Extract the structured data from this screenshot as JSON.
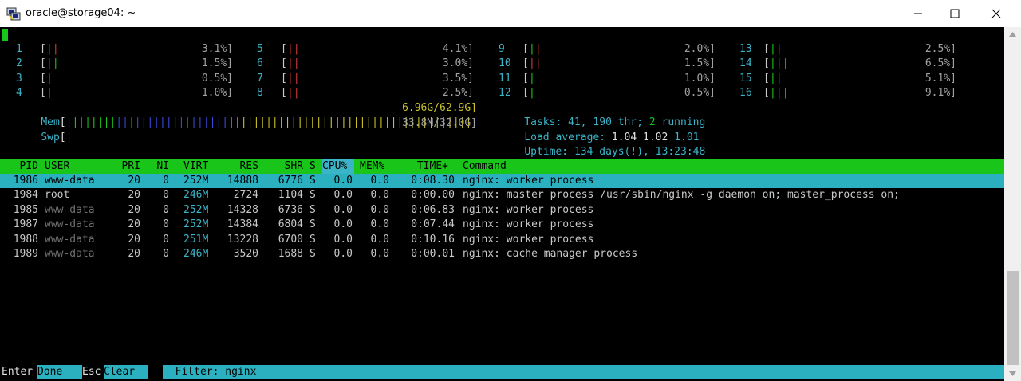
{
  "window": {
    "title": "oracle@storage04: ~"
  },
  "cpus": [
    {
      "id": "1",
      "bars": [
        [
          "r",
          2
        ]
      ],
      "pct": "3.1%]"
    },
    {
      "id": "2",
      "bars": [
        [
          "r",
          1
        ],
        [
          "g",
          1
        ]
      ],
      "pct": "1.5%]"
    },
    {
      "id": "3",
      "bars": [
        [
          "g",
          1
        ]
      ],
      "pct": "0.5%]"
    },
    {
      "id": "4",
      "bars": [
        [
          "g",
          1
        ]
      ],
      "pct": "1.0%]"
    },
    {
      "id": "5",
      "bars": [
        [
          "r",
          2
        ]
      ],
      "pct": "4.1%]"
    },
    {
      "id": "6",
      "bars": [
        [
          "r",
          2
        ]
      ],
      "pct": "3.0%]"
    },
    {
      "id": "7",
      "bars": [
        [
          "r",
          2
        ]
      ],
      "pct": "3.5%]"
    },
    {
      "id": "8",
      "bars": [
        [
          "r",
          2
        ]
      ],
      "pct": "2.5%]"
    },
    {
      "id": "9",
      "bars": [
        [
          "g",
          1
        ],
        [
          "r",
          1
        ]
      ],
      "pct": "2.0%]"
    },
    {
      "id": "10",
      "bars": [
        [
          "r",
          2
        ]
      ],
      "pct": "1.5%]"
    },
    {
      "id": "11",
      "bars": [
        [
          "g",
          1
        ]
      ],
      "pct": "1.0%]"
    },
    {
      "id": "12",
      "bars": [
        [
          "g",
          1
        ]
      ],
      "pct": "0.5%]"
    },
    {
      "id": "13",
      "bars": [
        [
          "g",
          1
        ],
        [
          "r",
          1
        ]
      ],
      "pct": "2.5%]"
    },
    {
      "id": "14",
      "bars": [
        [
          "g",
          1
        ],
        [
          "r",
          2
        ]
      ],
      "pct": "6.5%]"
    },
    {
      "id": "15",
      "bars": [
        [
          "g",
          1
        ],
        [
          "r",
          1
        ]
      ],
      "pct": "5.1%]"
    },
    {
      "id": "16",
      "bars": [
        [
          "g",
          1
        ],
        [
          "r",
          2
        ]
      ],
      "pct": "9.1%]"
    }
  ],
  "mem": {
    "label": "Mem",
    "value": "6.96G/62.9G]"
  },
  "swp": {
    "label": "Swp",
    "value": "33.8M/32.0G]"
  },
  "tasks": {
    "prefix": "Tasks: ",
    "count": "41",
    "sep1": ", ",
    "thr": "190",
    "thr_label": " thr; ",
    "running": "2",
    "running_label": " running"
  },
  "load": {
    "label": "Load average: ",
    "l1": "1.04",
    "l5": "1.02",
    "l15": "1.01"
  },
  "uptime": {
    "label": "Uptime: ",
    "value": "134 days(!), 13:23:48"
  },
  "table": {
    "headers": [
      "PID",
      "USER",
      "PRI",
      "NI",
      "VIRT",
      "RES",
      "SHR",
      "S",
      "CPU%",
      "MEM%",
      "TIME+",
      "Command"
    ],
    "rows": [
      {
        "pid": "1986",
        "user": "www-data",
        "pri": "20",
        "ni": "0",
        "virt": "252M",
        "res": "14888",
        "shr": "6776",
        "s": "S",
        "cpu": "0.0",
        "mem": "0.0",
        "time": "0:08.30",
        "cmd": "nginx: worker process"
      },
      {
        "pid": "1984",
        "user": "root",
        "pri": "20",
        "ni": "0",
        "virt": "246M",
        "res": "2724",
        "shr": "1104",
        "s": "S",
        "cpu": "0.0",
        "mem": "0.0",
        "time": "0:00.00",
        "cmd": "nginx: master process /usr/sbin/nginx -g daemon on; master_process on;"
      },
      {
        "pid": "1985",
        "user": "www-data",
        "pri": "20",
        "ni": "0",
        "virt": "252M",
        "res": "14328",
        "shr": "6736",
        "s": "S",
        "cpu": "0.0",
        "mem": "0.0",
        "time": "0:06.83",
        "cmd": "nginx: worker process"
      },
      {
        "pid": "1987",
        "user": "www-data",
        "pri": "20",
        "ni": "0",
        "virt": "252M",
        "res": "14384",
        "shr": "6804",
        "s": "S",
        "cpu": "0.0",
        "mem": "0.0",
        "time": "0:07.44",
        "cmd": "nginx: worker process"
      },
      {
        "pid": "1988",
        "user": "www-data",
        "pri": "20",
        "ni": "0",
        "virt": "251M",
        "res": "13228",
        "shr": "6700",
        "s": "S",
        "cpu": "0.0",
        "mem": "0.0",
        "time": "0:10.16",
        "cmd": "nginx: worker process"
      },
      {
        "pid": "1989",
        "user": "www-data",
        "pri": "20",
        "ni": "0",
        "virt": "246M",
        "res": "3520",
        "shr": "1688",
        "s": "S",
        "cpu": "0.0",
        "mem": "0.0",
        "time": "0:00.01",
        "cmd": "nginx: cache manager process"
      }
    ]
  },
  "bottom": {
    "enter_key": "Enter",
    "enter_label": "Done  ",
    "esc_key": "Esc",
    "esc_label": "Clear  ",
    "filter": "  Filter: nginx"
  },
  "colors": {
    "green": "#19c519",
    "cyan": "#2ab0bf",
    "red": "#d63b3b",
    "blue": "#3a48d8",
    "yellow": "#c8c02a"
  }
}
